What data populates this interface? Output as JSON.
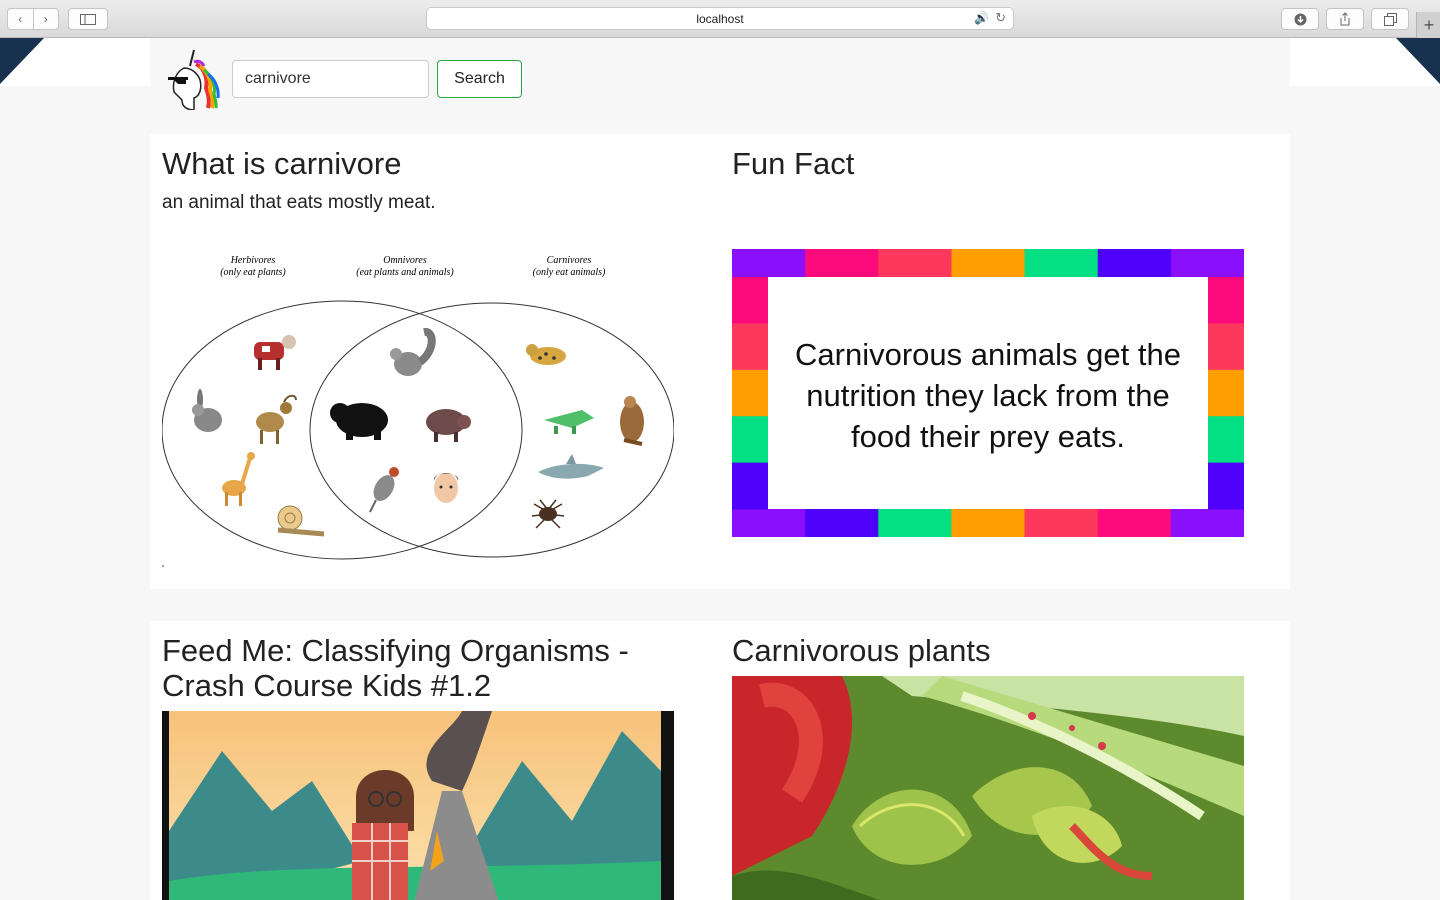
{
  "browser": {
    "url": "localhost"
  },
  "search": {
    "value": "carnivore",
    "button_label": "Search"
  },
  "definition": {
    "title": "What is carnivore",
    "text": "an animal that eats mostly meat."
  },
  "venn": {
    "labels": [
      {
        "name": "Herbivores",
        "sub": "(only eat plants)"
      },
      {
        "name": "Omnivores",
        "sub": "(eat plants and animals)"
      },
      {
        "name": "Carnivores",
        "sub": "(only eat animals)"
      }
    ]
  },
  "fun_fact": {
    "title": "Fun Fact",
    "lines": [
      "Carnivorous animals get the",
      "nutrition they lack from the",
      "food their prey eats."
    ],
    "border_colors": [
      "#8a0ffb",
      "#fb0a7c",
      "#fe375d",
      "#ff9e00",
      "#02e083",
      "#4f01fc",
      "#8a0ffb"
    ]
  },
  "video": {
    "title": "Feed Me: Classifying Organisms - Crash Course Kids #1.2"
  },
  "plants": {
    "title": "Carnivorous plants"
  }
}
